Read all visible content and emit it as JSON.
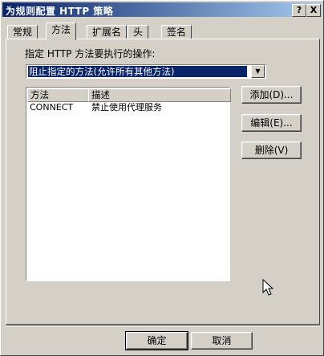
{
  "window": {
    "title": "为规则配置 HTTP 策略",
    "help_btn": "?",
    "close_btn": "X"
  },
  "tabs": [
    {
      "label": "常规"
    },
    {
      "label": "方法"
    },
    {
      "label": "扩展名"
    },
    {
      "label": "头"
    },
    {
      "label": "签名"
    }
  ],
  "panel": {
    "instruction": "指定 HTTP 方法要执行的操作:",
    "action_select_value": "阻止指定的方法(允许所有其他方法)",
    "table": {
      "columns": [
        "方法",
        "描述"
      ],
      "rows": [
        {
          "method": "CONNECT",
          "description": "禁止使用代理服务"
        }
      ]
    },
    "buttons": {
      "add": "添加(D)...",
      "edit": "编辑(E)...",
      "delete": "删除(V)"
    }
  },
  "footer": {
    "ok": "确定",
    "cancel": "取消"
  }
}
